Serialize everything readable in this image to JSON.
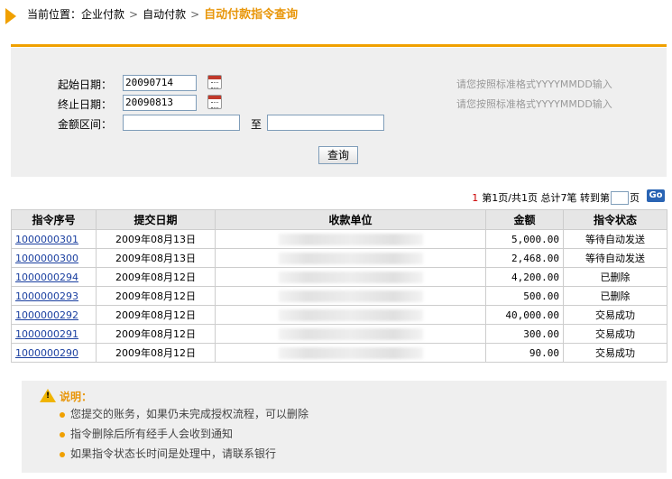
{
  "breadcrumb": {
    "prefix": "当前位置：",
    "items": [
      "企业付款",
      "自动付款"
    ],
    "current": "自动付款指令查询"
  },
  "form": {
    "start_date": {
      "label": "起始日期：",
      "value": "20090714",
      "hint": "请您按照标准格式YYYYMMDD输入"
    },
    "end_date": {
      "label": "终止日期：",
      "value": "20090813",
      "hint": "请您按照标准格式YYYYMMDD输入"
    },
    "amount_range": {
      "label": "金额区间：",
      "min": "",
      "max": "",
      "to_label": "至"
    },
    "query_button": "查询"
  },
  "pagination": {
    "page_num": "1",
    "text": "第1页/共1页 总计7笔 转到第",
    "page_suffix": "页",
    "go_label": "Go"
  },
  "table": {
    "headers": [
      "指令序号",
      "提交日期",
      "收款单位",
      "金额",
      "指令状态"
    ],
    "rows": [
      {
        "id": "1000000301",
        "date": "2009年08月13日",
        "amount": "5,000.00",
        "status": "等待自动发送"
      },
      {
        "id": "1000000300",
        "date": "2009年08月13日",
        "amount": "2,468.00",
        "status": "等待自动发送"
      },
      {
        "id": "1000000294",
        "date": "2009年08月12日",
        "amount": "4,200.00",
        "status": "已删除"
      },
      {
        "id": "1000000293",
        "date": "2009年08月12日",
        "amount": "500.00",
        "status": "已删除"
      },
      {
        "id": "1000000292",
        "date": "2009年08月12日",
        "amount": "40,000.00",
        "status": "交易成功"
      },
      {
        "id": "1000000291",
        "date": "2009年08月12日",
        "amount": "300.00",
        "status": "交易成功"
      },
      {
        "id": "1000000290",
        "date": "2009年08月12日",
        "amount": "90.00",
        "status": "交易成功"
      }
    ]
  },
  "notes": {
    "title": "说明：",
    "items": [
      "您提交的账务，如果仍未完成授权流程，可以删除",
      "指令删除后所有经手人会收到通知",
      "如果指令状态长时间是处理中，请联系银行"
    ]
  },
  "colors": {
    "accent": "#f0a000",
    "link": "#1a3fa0",
    "panel": "#efefef"
  }
}
